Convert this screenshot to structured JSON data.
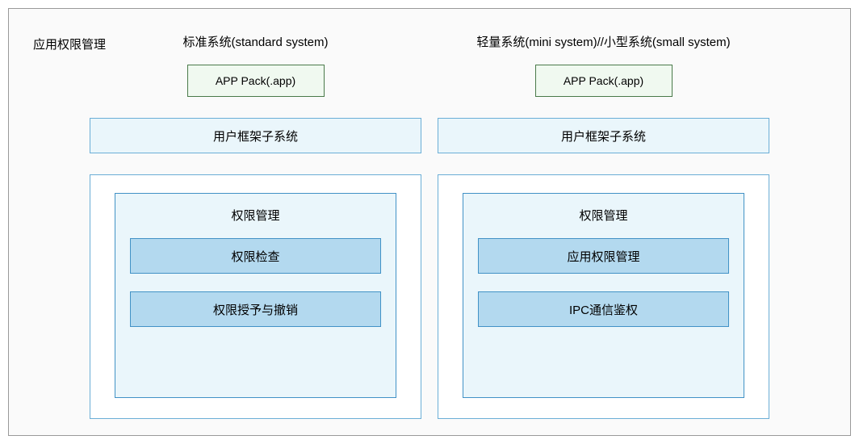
{
  "title": "应用权限管理",
  "left": {
    "system_label": "标准系统(standard system)",
    "app_pack": "APP Pack(.app)",
    "framework": "用户框架子系统",
    "permission_title": "权限管理",
    "items": [
      "权限检查",
      "权限授予与撤销"
    ]
  },
  "right": {
    "system_label": "轻量系统(mini system)//小型系统(small system)",
    "app_pack": "APP Pack(.app)",
    "framework": "用户框架子系统",
    "permission_title": "权限管理",
    "items": [
      "应用权限管理",
      "IPC通信鉴权"
    ]
  }
}
